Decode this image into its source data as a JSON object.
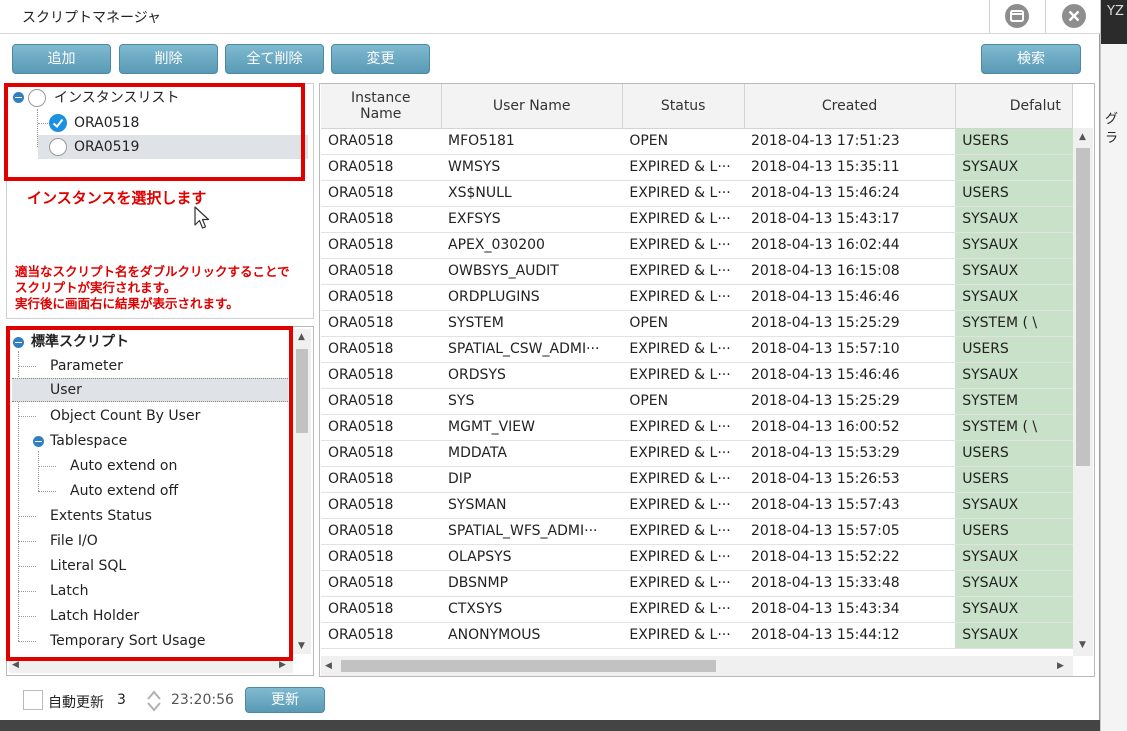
{
  "window": {
    "title": "スクリプトマネージャ"
  },
  "toolbar": {
    "add": "追加",
    "delete": "削除",
    "delete_all": "全て削除",
    "change": "変更",
    "search": "検索"
  },
  "instance_tree": {
    "root": "インスタンスリスト",
    "items": [
      {
        "label": "ORA0518",
        "checked": true
      },
      {
        "label": "ORA0519",
        "checked": false
      }
    ]
  },
  "annotations": {
    "select_instance": "インスタンスを選択します",
    "double_click_line1": "適当なスクリプト名をダブルクリックすることで",
    "double_click_line2": "スクリプトが実行されます。",
    "double_click_line3": "実行後に画面右に結果が表示されます。"
  },
  "script_tree": {
    "root": "標準スクリプト",
    "items": [
      {
        "label": "Parameter",
        "level": 1
      },
      {
        "label": "User",
        "level": 1,
        "selected": true
      },
      {
        "label": "Object Count By User",
        "level": 1
      },
      {
        "label": "Tablespace",
        "level": 1,
        "expanded": true
      },
      {
        "label": "Auto extend on",
        "level": 2
      },
      {
        "label": "Auto extend off",
        "level": 2
      },
      {
        "label": "Extents Status",
        "level": 1
      },
      {
        "label": "File I/O",
        "level": 1
      },
      {
        "label": "Literal SQL",
        "level": 1
      },
      {
        "label": "Latch",
        "level": 1
      },
      {
        "label": "Latch Holder",
        "level": 1
      },
      {
        "label": "Temporary Sort Usage",
        "level": 1
      }
    ]
  },
  "grid": {
    "columns": [
      "Instance Name",
      "User Name",
      "Status",
      "Created",
      "Defalut"
    ],
    "rows": [
      [
        "ORA0518",
        "MFO5181",
        "OPEN",
        "2018-04-13 17:51:23",
        "USERS"
      ],
      [
        "ORA0518",
        "WMSYS",
        "EXPIRED & L···",
        "2018-04-13 15:35:11",
        "SYSAUX"
      ],
      [
        "ORA0518",
        "XS$NULL",
        "EXPIRED & L···",
        "2018-04-13 15:46:24",
        "USERS"
      ],
      [
        "ORA0518",
        "EXFSYS",
        "EXPIRED & L···",
        "2018-04-13 15:43:17",
        "SYSAUX"
      ],
      [
        "ORA0518",
        "APEX_030200",
        "EXPIRED & L···",
        "2018-04-13 16:02:44",
        "SYSAUX"
      ],
      [
        "ORA0518",
        "OWBSYS_AUDIT",
        "EXPIRED & L···",
        "2018-04-13 16:15:08",
        "SYSAUX"
      ],
      [
        "ORA0518",
        "ORDPLUGINS",
        "EXPIRED & L···",
        "2018-04-13 15:46:46",
        "SYSAUX"
      ],
      [
        "ORA0518",
        "SYSTEM",
        "OPEN",
        "2018-04-13 15:25:29",
        "SYSTEM ( \\"
      ],
      [
        "ORA0518",
        "SPATIAL_CSW_ADMI···",
        "EXPIRED & L···",
        "2018-04-13 15:57:10",
        "USERS"
      ],
      [
        "ORA0518",
        "ORDSYS",
        "EXPIRED & L···",
        "2018-04-13 15:46:46",
        "SYSAUX"
      ],
      [
        "ORA0518",
        "SYS",
        "OPEN",
        "2018-04-13 15:25:29",
        "SYSTEM"
      ],
      [
        "ORA0518",
        "MGMT_VIEW",
        "EXPIRED & L···",
        "2018-04-13 16:00:52",
        "SYSTEM ( \\"
      ],
      [
        "ORA0518",
        "MDDATA",
        "EXPIRED & L···",
        "2018-04-13 15:53:29",
        "USERS"
      ],
      [
        "ORA0518",
        "DIP",
        "EXPIRED & L···",
        "2018-04-13 15:26:53",
        "USERS"
      ],
      [
        "ORA0518",
        "SYSMAN",
        "EXPIRED & L···",
        "2018-04-13 15:57:43",
        "SYSAUX"
      ],
      [
        "ORA0518",
        "SPATIAL_WFS_ADMI···",
        "EXPIRED & L···",
        "2018-04-13 15:57:05",
        "USERS"
      ],
      [
        "ORA0518",
        "OLAPSYS",
        "EXPIRED & L···",
        "2018-04-13 15:52:22",
        "SYSAUX"
      ],
      [
        "ORA0518",
        "DBSNMP",
        "EXPIRED & L···",
        "2018-04-13 15:33:48",
        "SYSAUX"
      ],
      [
        "ORA0518",
        "CTXSYS",
        "EXPIRED & L···",
        "2018-04-13 15:43:34",
        "SYSAUX"
      ],
      [
        "ORA0518",
        "ANONYMOUS",
        "EXPIRED & L···",
        "2018-04-13 15:44:12",
        "SYSAUX"
      ]
    ]
  },
  "bottom": {
    "auto_refresh_label": "自動更新",
    "interval": "3",
    "time": "23:20:56",
    "refresh_button": "更新"
  },
  "background_window": {
    "fragment_top": "YZ",
    "fragment_mid": "グラ"
  },
  "icons": {
    "restore": "restore-window-icon",
    "close": "close-icon",
    "cursor": "mouse-pointer-icon",
    "spinner": "spinner-arrows-icon"
  },
  "colors": {
    "accent": "#5a9ab5",
    "highlight_box": "#e00000",
    "default_cell": "#c8e1c8",
    "checked": "#1e90e0"
  }
}
